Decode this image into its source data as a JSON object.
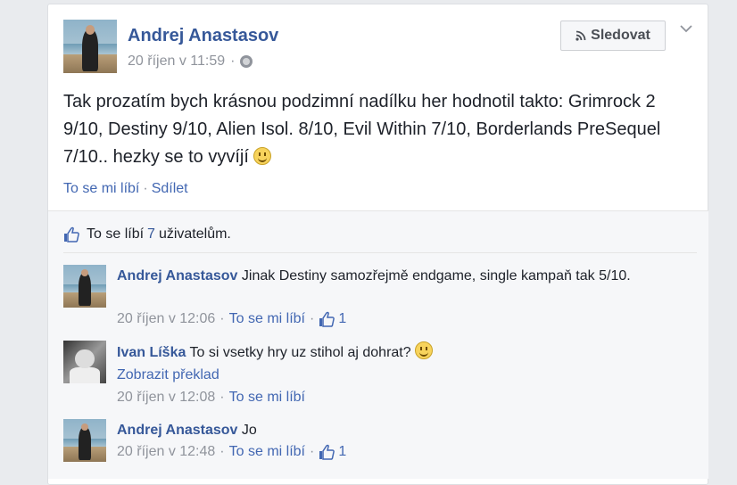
{
  "post": {
    "author": "Andrej Anastasov",
    "timestamp": "20 říjen v 11:59",
    "follow_label": "Sledovat",
    "text": "Tak prozatím bych krásnou podzimní nadílku her hodnotil takto: Grimrock 2 9/10, Destiny 9/10, Alien Isol. 8/10, Evil Within 7/10, Borderlands PreSequel 7/10.. hezky se to vyvíjí",
    "like_label": "To se mi líbí",
    "share_label": "Sdílet"
  },
  "likes_summary": {
    "prefix": "To se líbí",
    "count": "7",
    "suffix": "uživatelům."
  },
  "comments": [
    {
      "author": "Andrej Anastasov",
      "text": "Jinak Destiny samozřejmě endgame, single kampaň tak 5/10.",
      "timestamp": "20 říjen v 12:06",
      "like_label": "To se mi líbí",
      "likes": "1"
    },
    {
      "author": "Ivan Líška",
      "text": "To si vsetky hry uz stihol aj dohrat?",
      "translate_label": "Zobrazit překlad",
      "timestamp": "20 říjen v 12:08",
      "like_label": "To se mi líbí"
    },
    {
      "author": "Andrej Anastasov",
      "text": "Jo",
      "timestamp": "20 říjen v 12:48",
      "like_label": "To se mi líbí",
      "likes": "1"
    }
  ],
  "icons": {
    "follow": "rss-icon",
    "menu": "chevron-down-icon",
    "privacy": "globe-icon",
    "like": "thumbs-up-icon",
    "emoji": "smiley-icon"
  },
  "colors": {
    "link": "#4267b2",
    "name": "#365899",
    "meta": "#90949c",
    "background": "#e9ebee"
  }
}
